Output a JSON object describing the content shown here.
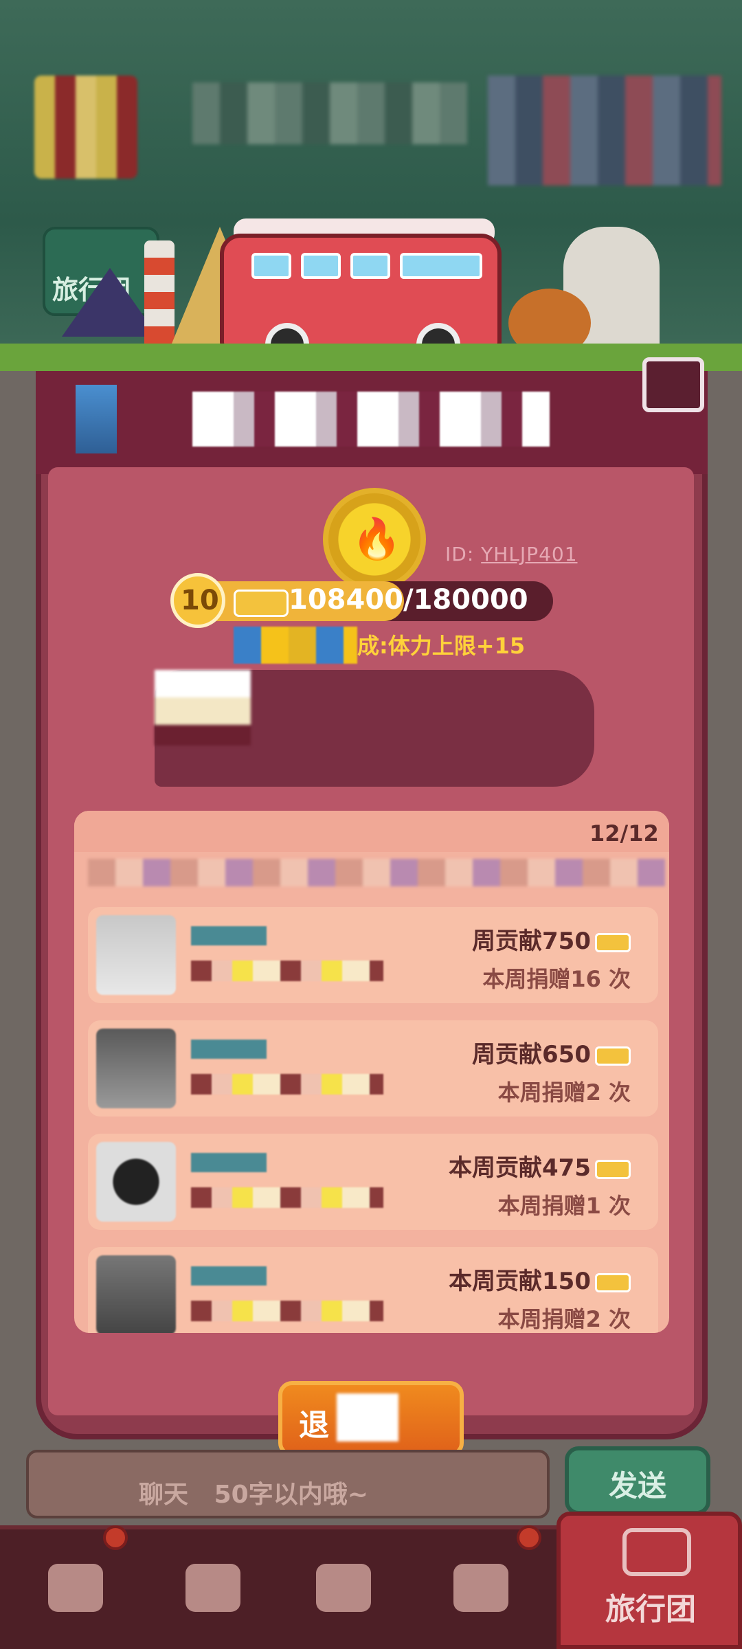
{
  "top_scene": {
    "side_tag_label": "旅行团"
  },
  "team": {
    "id_prefix": "ID:",
    "id_value": "YHLJP401",
    "level": "10",
    "xp_text": "108400/180000",
    "xp_fraction": 0.6022,
    "reward_text": "成:体力上限+15"
  },
  "members": {
    "count": "12/12",
    "rows": [
      {
        "contribution": "周贡献750",
        "donations": "本周捐赠16 次"
      },
      {
        "contribution": "周贡献650",
        "donations": "本周捐赠2 次"
      },
      {
        "contribution": "本周贡献475",
        "donations": "本周捐赠1 次"
      },
      {
        "contribution": "本周贡献150",
        "donations": "本周捐赠2 次"
      }
    ]
  },
  "actions": {
    "exit_button": "退      团"
  },
  "chat": {
    "placeholder": "聊天   50字以内哦~",
    "send_label": "发送"
  },
  "tabbar": {
    "active_label": "旅行团"
  },
  "colors": {
    "panel": "#8e3b4d",
    "accent": "#f08a1e",
    "send": "#3f8a6a"
  }
}
